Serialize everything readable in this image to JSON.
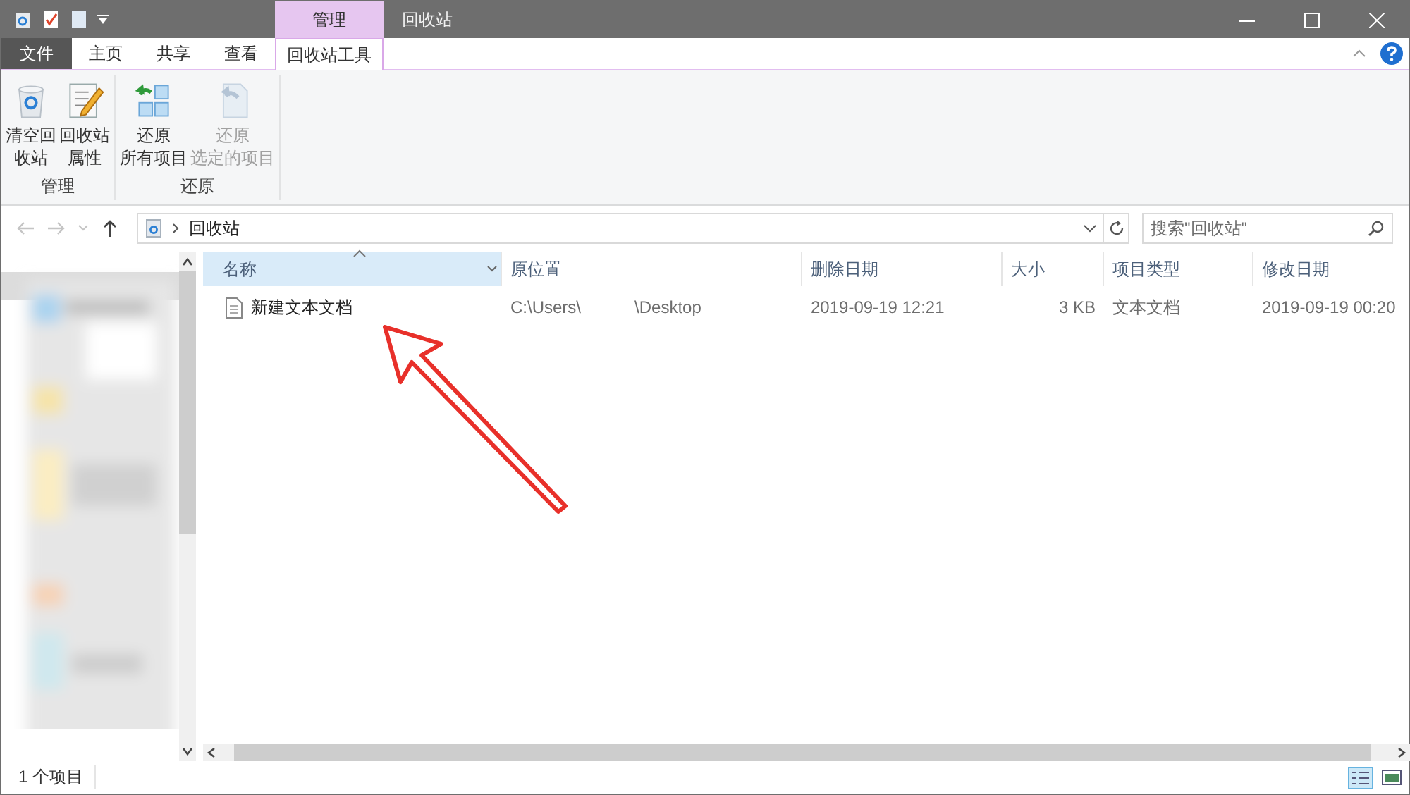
{
  "window": {
    "context_tab": "管理",
    "title": "回收站"
  },
  "ribbon": {
    "tabs": [
      {
        "label": "文件",
        "kind": "file",
        "selected": false
      },
      {
        "label": "主页",
        "kind": "tab",
        "selected": false
      },
      {
        "label": "共享",
        "kind": "tab",
        "selected": false
      },
      {
        "label": "查看",
        "kind": "tab",
        "selected": false
      },
      {
        "label": "回收站工具",
        "kind": "tab",
        "selected": true
      }
    ],
    "groups": [
      {
        "label": "管理",
        "buttons": [
          {
            "lines": [
              "清空回",
              "收站"
            ],
            "disabled": false
          },
          {
            "lines": [
              "回收站",
              "属性"
            ],
            "disabled": false
          }
        ]
      },
      {
        "label": "还原",
        "buttons": [
          {
            "lines": [
              "还原",
              "所有项目"
            ],
            "disabled": false
          },
          {
            "lines": [
              "还原",
              "选定的项目"
            ],
            "disabled": true
          }
        ]
      }
    ]
  },
  "address": {
    "path": "回收站",
    "search_placeholder": "搜索\"回收站\""
  },
  "columns": [
    {
      "label": "名称",
      "sorted": true
    },
    {
      "label": "原位置",
      "sorted": false
    },
    {
      "label": "删除日期",
      "sorted": false
    },
    {
      "label": "大小",
      "sorted": false
    },
    {
      "label": "项目类型",
      "sorted": false
    },
    {
      "label": "修改日期",
      "sorted": false
    }
  ],
  "rows": [
    {
      "name": "新建文本文档",
      "location": [
        "C:\\Users\\",
        "\\Desktop"
      ],
      "deleted": "2019-09-19 12:21",
      "size": "3 KB",
      "type": "文本文档",
      "modified": "2019-09-19 00:20"
    }
  ],
  "status_bar": {
    "count": "1 个项目"
  }
}
